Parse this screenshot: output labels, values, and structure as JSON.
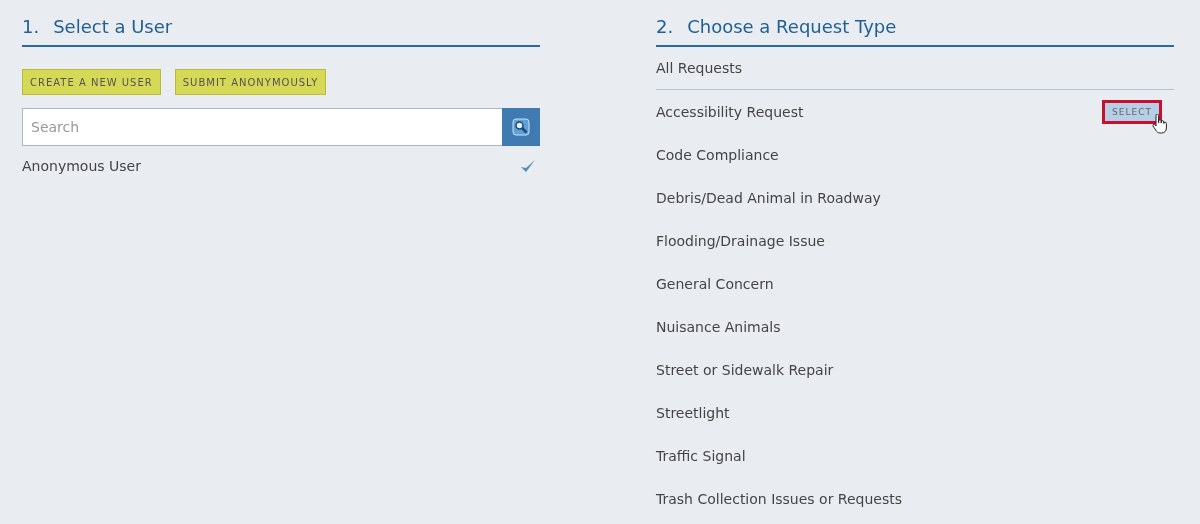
{
  "user_panel": {
    "number": "1.",
    "title": "Select a User",
    "buttons": [
      "CREATE A NEW USER",
      "SUBMIT ANONYMOUSLY"
    ],
    "search": {
      "placeholder": "Search"
    },
    "users": [
      {
        "name": "Anonymous User",
        "selected": true
      }
    ]
  },
  "request_panel": {
    "number": "2.",
    "title": "Choose a Request Type",
    "select_label": "SELECT",
    "request_types": [
      {
        "name": "All Requests",
        "hovered": false
      },
      {
        "name": "Accessibility Request",
        "hovered": true
      },
      {
        "name": "Code Compliance",
        "hovered": false
      },
      {
        "name": "Debris/Dead Animal in Roadway",
        "hovered": false
      },
      {
        "name": "Flooding/Drainage Issue",
        "hovered": false
      },
      {
        "name": "General Concern",
        "hovered": false
      },
      {
        "name": "Nuisance Animals",
        "hovered": false
      },
      {
        "name": "Street or Sidewalk Repair",
        "hovered": false
      },
      {
        "name": "Streetlight",
        "hovered": false
      },
      {
        "name": "Traffic Signal",
        "hovered": false
      },
      {
        "name": "Trash Collection Issues or Requests",
        "hovered": false
      }
    ]
  }
}
